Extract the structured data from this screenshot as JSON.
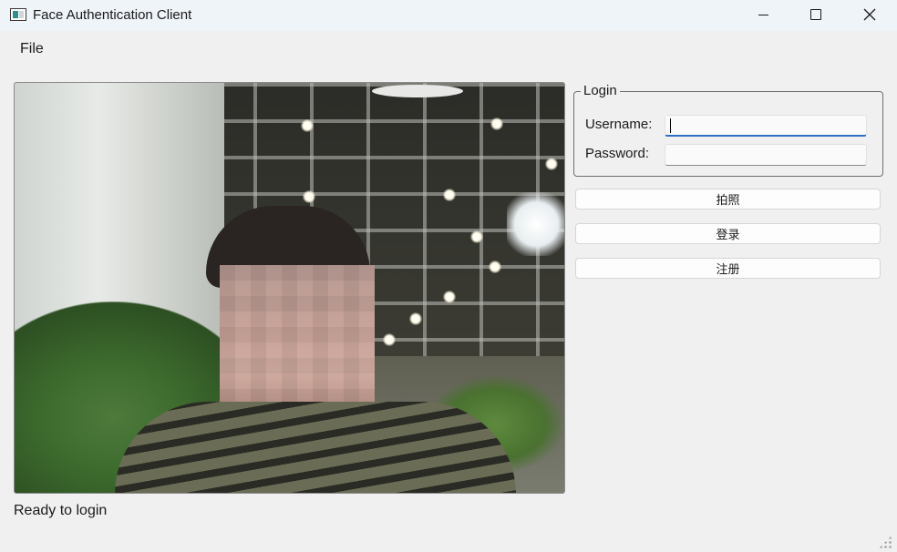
{
  "window": {
    "title": "Face Authentication Client"
  },
  "menu": {
    "file": "File"
  },
  "login_group": {
    "title": "Login",
    "username_label": "Username:",
    "username_value": "",
    "password_label": "Password:",
    "password_value": ""
  },
  "buttons": {
    "take_photo": "拍照",
    "login": "登录",
    "register": "注册"
  },
  "status": {
    "text": "Ready to login"
  },
  "camera": {
    "description_icon": "camera-feed"
  }
}
